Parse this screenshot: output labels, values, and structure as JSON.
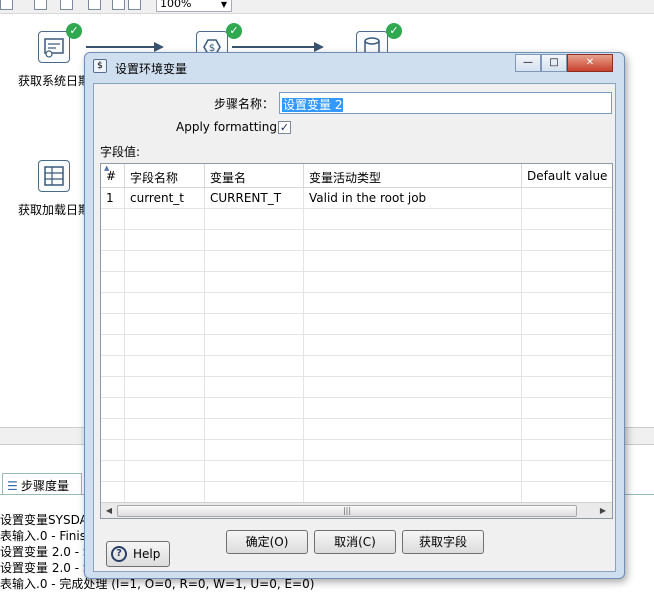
{
  "toolbar": {
    "zoom_value": "100%"
  },
  "canvas": {
    "steps": [
      {
        "label": "获取系统日期"
      },
      {
        "label": "获取加载日期"
      }
    ],
    "status": "completed"
  },
  "bottom_panel": {
    "tab_label": "步骤度量",
    "log_lines": [
      "设置变量SYSDA",
      "表输入.0 - Finish",
      "设置变量 2.0 - S",
      "设置变量 2.0 - S",
      "表输入.0 - 完成处理 (I=1, O=0, R=0, W=1, U=0, E=0)"
    ]
  },
  "dialog": {
    "title": "设置环境变量",
    "window_buttons": {
      "minimize": "—",
      "maximize": "□",
      "close": "✕"
    },
    "step_name_label": "步骤名称：",
    "step_name_value": "设置变量 2",
    "apply_formatting_label": "Apply formatting",
    "apply_formatting_checked": "✓",
    "fields_label": "字段值:",
    "table": {
      "columns": [
        "#",
        "字段名称",
        "变量名",
        "变量活动类型",
        "Default value"
      ],
      "rows": [
        [
          "1",
          "current_t",
          "CURRENT_T",
          "Valid in the root job",
          ""
        ]
      ]
    },
    "buttons": {
      "ok": "确定(O)",
      "cancel": "取消(C)",
      "get_fields": "获取字段",
      "help": "Help"
    }
  }
}
